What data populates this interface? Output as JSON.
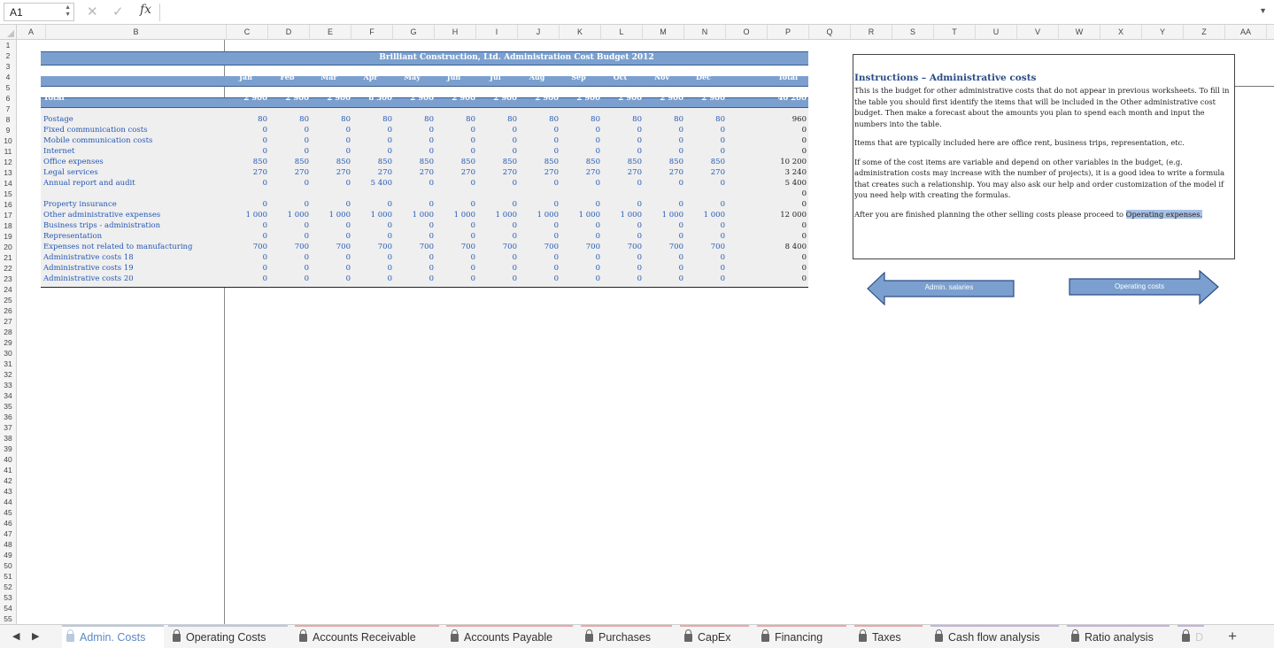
{
  "formula_bar": {
    "name_box": "A1",
    "cancel": "✕",
    "confirm": "✓",
    "fx": "fx",
    "menu": "▼",
    "spin": "▲\n▼"
  },
  "columns": [
    "A",
    "B",
    "C",
    "D",
    "E",
    "F",
    "G",
    "H",
    "I",
    "J",
    "K",
    "L",
    "M",
    "N",
    "O",
    "P",
    "Q",
    "R",
    "S",
    "T",
    "U",
    "V",
    "W",
    "X",
    "Y",
    "Z",
    "AA"
  ],
  "rows": [
    "1",
    "2",
    "3",
    "4",
    "5",
    "6",
    "7",
    "8",
    "9",
    "10",
    "11",
    "12",
    "13",
    "14",
    "15",
    "16",
    "17",
    "18",
    "19",
    "20",
    "21",
    "22",
    "23",
    "24",
    "25",
    "26",
    "27",
    "28",
    "29",
    "30",
    "31",
    "32",
    "33",
    "34",
    "35",
    "36",
    "37",
    "38",
    "39",
    "40",
    "41",
    "42",
    "43",
    "44",
    "45",
    "46",
    "47",
    "48",
    "49",
    "50",
    "51",
    "52",
    "53",
    "54",
    "55"
  ],
  "table": {
    "title": "Brilliant Construction, Ltd. Administration Cost Budget 2012",
    "months": [
      "Jan",
      "Feb",
      "Mar",
      "Apr",
      "May",
      "Jun",
      "Jul",
      "Aug",
      "Sep",
      "Oct",
      "Nov",
      "Dec"
    ],
    "total_header": "Total",
    "total_row": {
      "label": "Total",
      "values": [
        "2 900",
        "2 900",
        "2 900",
        "8 300",
        "2 900",
        "2 900",
        "2 900",
        "2 900",
        "2 900",
        "2 900",
        "2 900",
        "2 900"
      ],
      "total": "40 200"
    },
    "items": [
      {
        "row": 8,
        "label": "Postage",
        "values": [
          "80",
          "80",
          "80",
          "80",
          "80",
          "80",
          "80",
          "80",
          "80",
          "80",
          "80",
          "80"
        ],
        "total": "960"
      },
      {
        "row": 9,
        "label": "Fixed communication costs",
        "values": [
          "0",
          "0",
          "0",
          "0",
          "0",
          "0",
          "0",
          "0",
          "0",
          "0",
          "0",
          "0"
        ],
        "total": "0"
      },
      {
        "row": 10,
        "label": "Mobile communication costs",
        "values": [
          "0",
          "0",
          "0",
          "0",
          "0",
          "0",
          "0",
          "0",
          "0",
          "0",
          "0",
          "0"
        ],
        "total": "0"
      },
      {
        "row": 11,
        "label": "Internet",
        "values": [
          "0",
          "0",
          "0",
          "0",
          "0",
          "0",
          "0",
          "0",
          "0",
          "0",
          "0",
          "0"
        ],
        "total": "0"
      },
      {
        "row": 12,
        "label": "Office expenses",
        "values": [
          "850",
          "850",
          "850",
          "850",
          "850",
          "850",
          "850",
          "850",
          "850",
          "850",
          "850",
          "850"
        ],
        "total": "10 200"
      },
      {
        "row": 13,
        "label": "Legal services",
        "values": [
          "270",
          "270",
          "270",
          "270",
          "270",
          "270",
          "270",
          "270",
          "270",
          "270",
          "270",
          "270"
        ],
        "total": "3 240"
      },
      {
        "row": 14,
        "label": "Annual report and audit",
        "values": [
          "0",
          "0",
          "0",
          "5 400",
          "0",
          "0",
          "0",
          "0",
          "0",
          "0",
          "0",
          "0"
        ],
        "total": "5 400"
      },
      {
        "row": 15,
        "label": "",
        "values": [
          "",
          "",
          "",
          "",
          "",
          "",
          "",
          "",
          "",
          "",
          "",
          ""
        ],
        "total": "0"
      },
      {
        "row": 16,
        "label": "Property insurance",
        "values": [
          "0",
          "0",
          "0",
          "0",
          "0",
          "0",
          "0",
          "0",
          "0",
          "0",
          "0",
          "0"
        ],
        "total": "0"
      },
      {
        "row": 17,
        "label": "Other administrative expenses",
        "values": [
          "1 000",
          "1 000",
          "1 000",
          "1 000",
          "1 000",
          "1 000",
          "1 000",
          "1 000",
          "1 000",
          "1 000",
          "1 000",
          "1 000"
        ],
        "total": "12 000"
      },
      {
        "row": 18,
        "label": "Business trips - administration",
        "values": [
          "0",
          "0",
          "0",
          "0",
          "0",
          "0",
          "0",
          "0",
          "0",
          "0",
          "0",
          "0"
        ],
        "total": "0"
      },
      {
        "row": 19,
        "label": "Representation",
        "values": [
          "0",
          "0",
          "0",
          "0",
          "0",
          "0",
          "0",
          "0",
          "0",
          "0",
          "0",
          "0"
        ],
        "total": "0"
      },
      {
        "row": 20,
        "label": "Expenses not related to manufacturing",
        "values": [
          "700",
          "700",
          "700",
          "700",
          "700",
          "700",
          "700",
          "700",
          "700",
          "700",
          "700",
          "700"
        ],
        "total": "8 400"
      },
      {
        "row": 21,
        "label": "Administrative costs 18",
        "values": [
          "0",
          "0",
          "0",
          "0",
          "0",
          "0",
          "0",
          "0",
          "0",
          "0",
          "0",
          "0"
        ],
        "total": "0"
      },
      {
        "row": 22,
        "label": "Administrative costs 19",
        "values": [
          "0",
          "0",
          "0",
          "0",
          "0",
          "0",
          "0",
          "0",
          "0",
          "0",
          "0",
          "0"
        ],
        "total": "0"
      },
      {
        "row": 23,
        "label": "Administrative costs 20",
        "values": [
          "0",
          "0",
          "0",
          "0",
          "0",
          "0",
          "0",
          "0",
          "0",
          "0",
          "0",
          "0"
        ],
        "total": "0"
      }
    ]
  },
  "instructions": {
    "title": "Instructions – Administrative costs",
    "p1": "This is the budget for other administrative costs that do not appear in previous worksheets. To fill in the table you should first identify the items that will be included in the Other administrative cost budget. Then make a forecast about the amounts you plan to spend each month and input the numbers into the table.",
    "p2": "Items that are typically included here are office rent, business trips, representation, etc.",
    "p3": "If some of the cost items are variable and depend on other variables in the budget, (e.g. administration costs may increase with the number of projects), it is a good idea to write a formula that creates such a relationship. You may also ask our help and order customization of the model if you need help with creating the formulas.",
    "p4_pre": "After you are finished planning the other selling costs please proceed to ",
    "p4_link": "Operating expenses."
  },
  "buttons": {
    "back": "Admin. salaries",
    "next": "Operating costs"
  },
  "colors": {
    "band": "#7ba0cf",
    "text_blue": "#2458b3",
    "tab_active": "#5c88c5"
  },
  "tabs": [
    "Admin. Costs",
    "Operating Costs",
    "Accounts Receivable",
    "Accounts Payable",
    "Purchases",
    "CapEx",
    "Financing",
    "Taxes",
    "Cash flow analysis",
    "Ratio analysis",
    "D"
  ],
  "tab_nav": {
    "prev": "◀",
    "next": "▶",
    "add": "+"
  }
}
